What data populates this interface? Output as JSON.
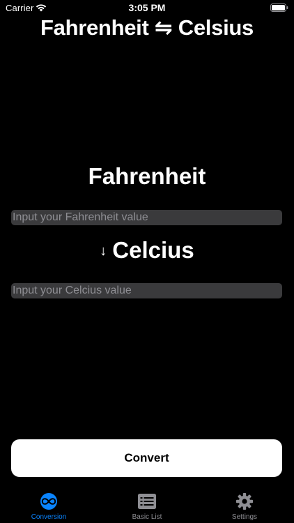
{
  "status_bar": {
    "carrier": "Carrier",
    "time": "3:05 PM",
    "wifi_icon": "wifi-icon",
    "battery_icon": "battery-icon"
  },
  "header": {
    "title": "Fahrenheit ⇋ Celsius"
  },
  "fahrenheit": {
    "label": "Fahrenheit",
    "input_value": "",
    "input_placeholder": "Input your Fahrenheit value"
  },
  "celsius": {
    "arrow": "↓",
    "label": "Celcius",
    "input_value": "",
    "input_placeholder": "Input your Celcius value"
  },
  "actions": {
    "convert_label": "Convert"
  },
  "tab_bar": {
    "selected": "Conversion",
    "tabs": [
      {
        "label": "Conversion",
        "icon": "infinity-icon"
      },
      {
        "label": "Basic List",
        "icon": "list-icon"
      },
      {
        "label": "Settings",
        "icon": "gear-icon"
      }
    ]
  },
  "colors": {
    "background": "#000000",
    "accent": "#0a84ff",
    "field_background": "#3a3a3c",
    "inactive_tab": "#8e8e93",
    "button_background": "#ffffff"
  }
}
